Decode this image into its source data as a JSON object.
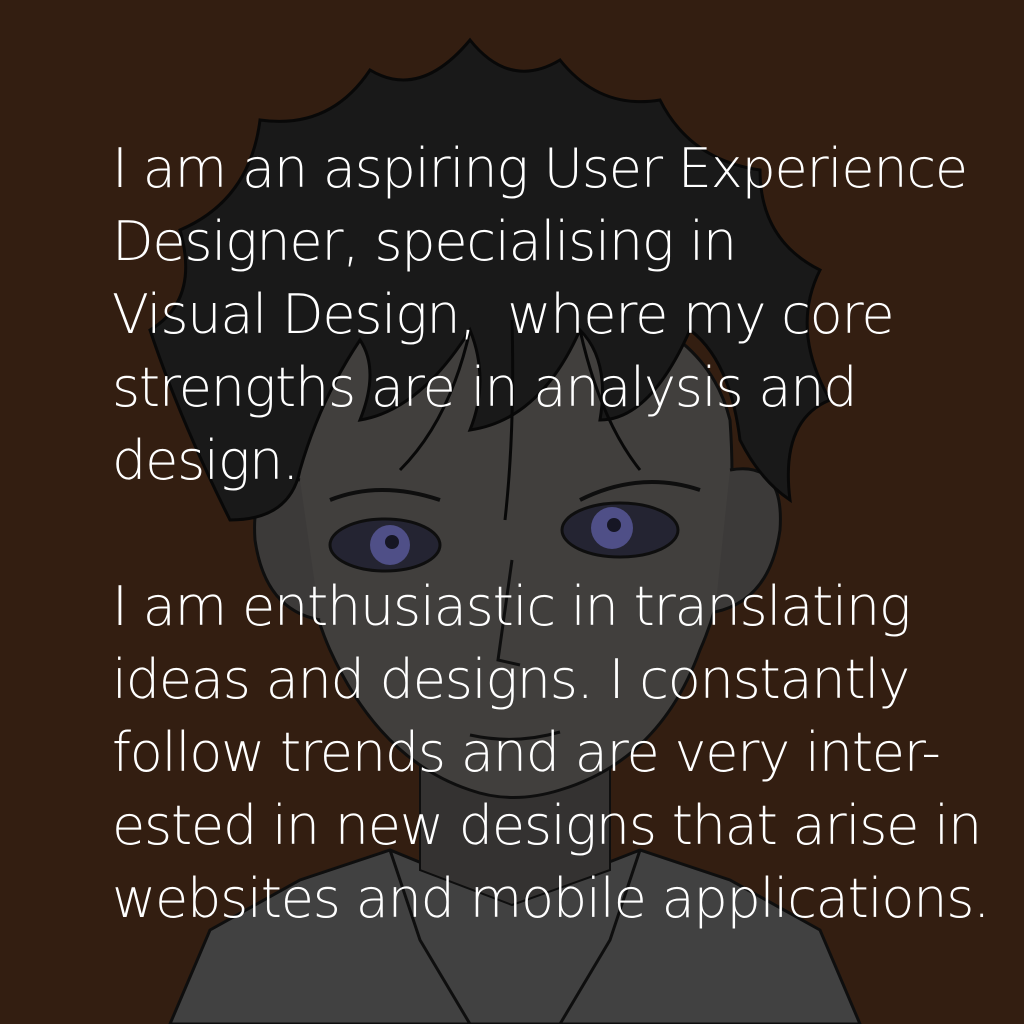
{
  "background_color": "#3b2314",
  "illustration": {
    "icon": "anime-boy-portrait",
    "hair_color": "#1d1d1d",
    "skin_color": "#4a4846",
    "eye_color": "#5a5a9a",
    "shirt_color": "#4b4b4b"
  },
  "text": {
    "color": "#ffffff",
    "paragraphs": [
      {
        "lines": [
          "I am an aspiring User Experience",
          "Designer, specialising in",
          "Visual Design,  where my core",
          "strengths are in analysis and",
          "design."
        ]
      },
      {
        "lines": [
          "I am enthusiastic in translating",
          "ideas and designs. I constantly",
          "follow trends and are very inter-",
          "ested in new designs that arise in",
          "websites and mobile applications."
        ]
      }
    ]
  }
}
